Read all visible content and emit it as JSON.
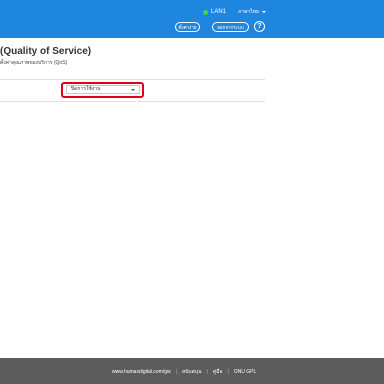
{
  "header": {
    "status_label": "LAN1",
    "language_label": "ภาษาไทย",
    "settings_button": "ตั้งค่าง่าย",
    "logout_button": "ออกจากระบบ",
    "help_label": "?"
  },
  "page": {
    "title": "(Quality of Service)",
    "subtitle": "ตั้งค่าคุณภาพของบริการ (QoS)",
    "qos_select_value": "ปิดการใช้งาน"
  },
  "footer": {
    "website": "www.humaxdigital.com/gw",
    "separator": "|",
    "support": "สนับสนุน",
    "manual": "คู่มือ",
    "gpl": "ONU GPL"
  },
  "colors": {
    "header_bg": "#1f86e0",
    "footer_bg": "#5c5c5c",
    "highlight": "#e0001b",
    "status_dot": "#46d24a"
  }
}
